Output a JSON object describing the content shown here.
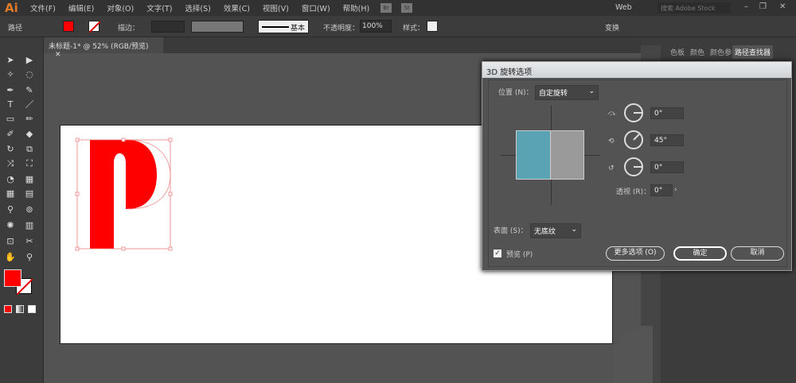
{
  "app": {
    "logo": "Ai",
    "menus": [
      "文件(F)",
      "编辑(E)",
      "对象(O)",
      "文字(T)",
      "选择(S)",
      "效果(C)",
      "视图(V)",
      "窗口(W)",
      "帮助(H)"
    ],
    "bridge": "Br",
    "stock": "St",
    "workspace": "Web",
    "search_placeholder": "搜索 Adobe Stock"
  },
  "control": {
    "object_type": "路径",
    "stroke_label": "描边：",
    "stroke_profile": "基本",
    "opacity_label": "不透明度：",
    "opacity": "100%",
    "style_label": "样式：",
    "transform": "变换"
  },
  "document": {
    "tab": "未标题-1* @ 52% (RGB/预览)"
  },
  "panel": {
    "tabs": [
      "色板",
      "颜色",
      "颜色参",
      "路径查找器"
    ]
  },
  "colors": {
    "fill": "#ff0000",
    "cube_front": "#5aa3b5",
    "cube_side": "#9a9a9a"
  },
  "dialog": {
    "title": "3D 旋转选项",
    "position_label": "位置 (N)：",
    "position_value": "自定旋转",
    "x_angle": "0°",
    "y_angle": "45°",
    "z_angle": "0°",
    "perspective_label": "透视 (R)：",
    "perspective": "0°",
    "surface_label": "表面 (S)：",
    "surface_value": "无底纹",
    "preview_label": "预览 (P)",
    "more_options": "更多选项 (O)",
    "ok": "确定",
    "cancel": "取消"
  }
}
